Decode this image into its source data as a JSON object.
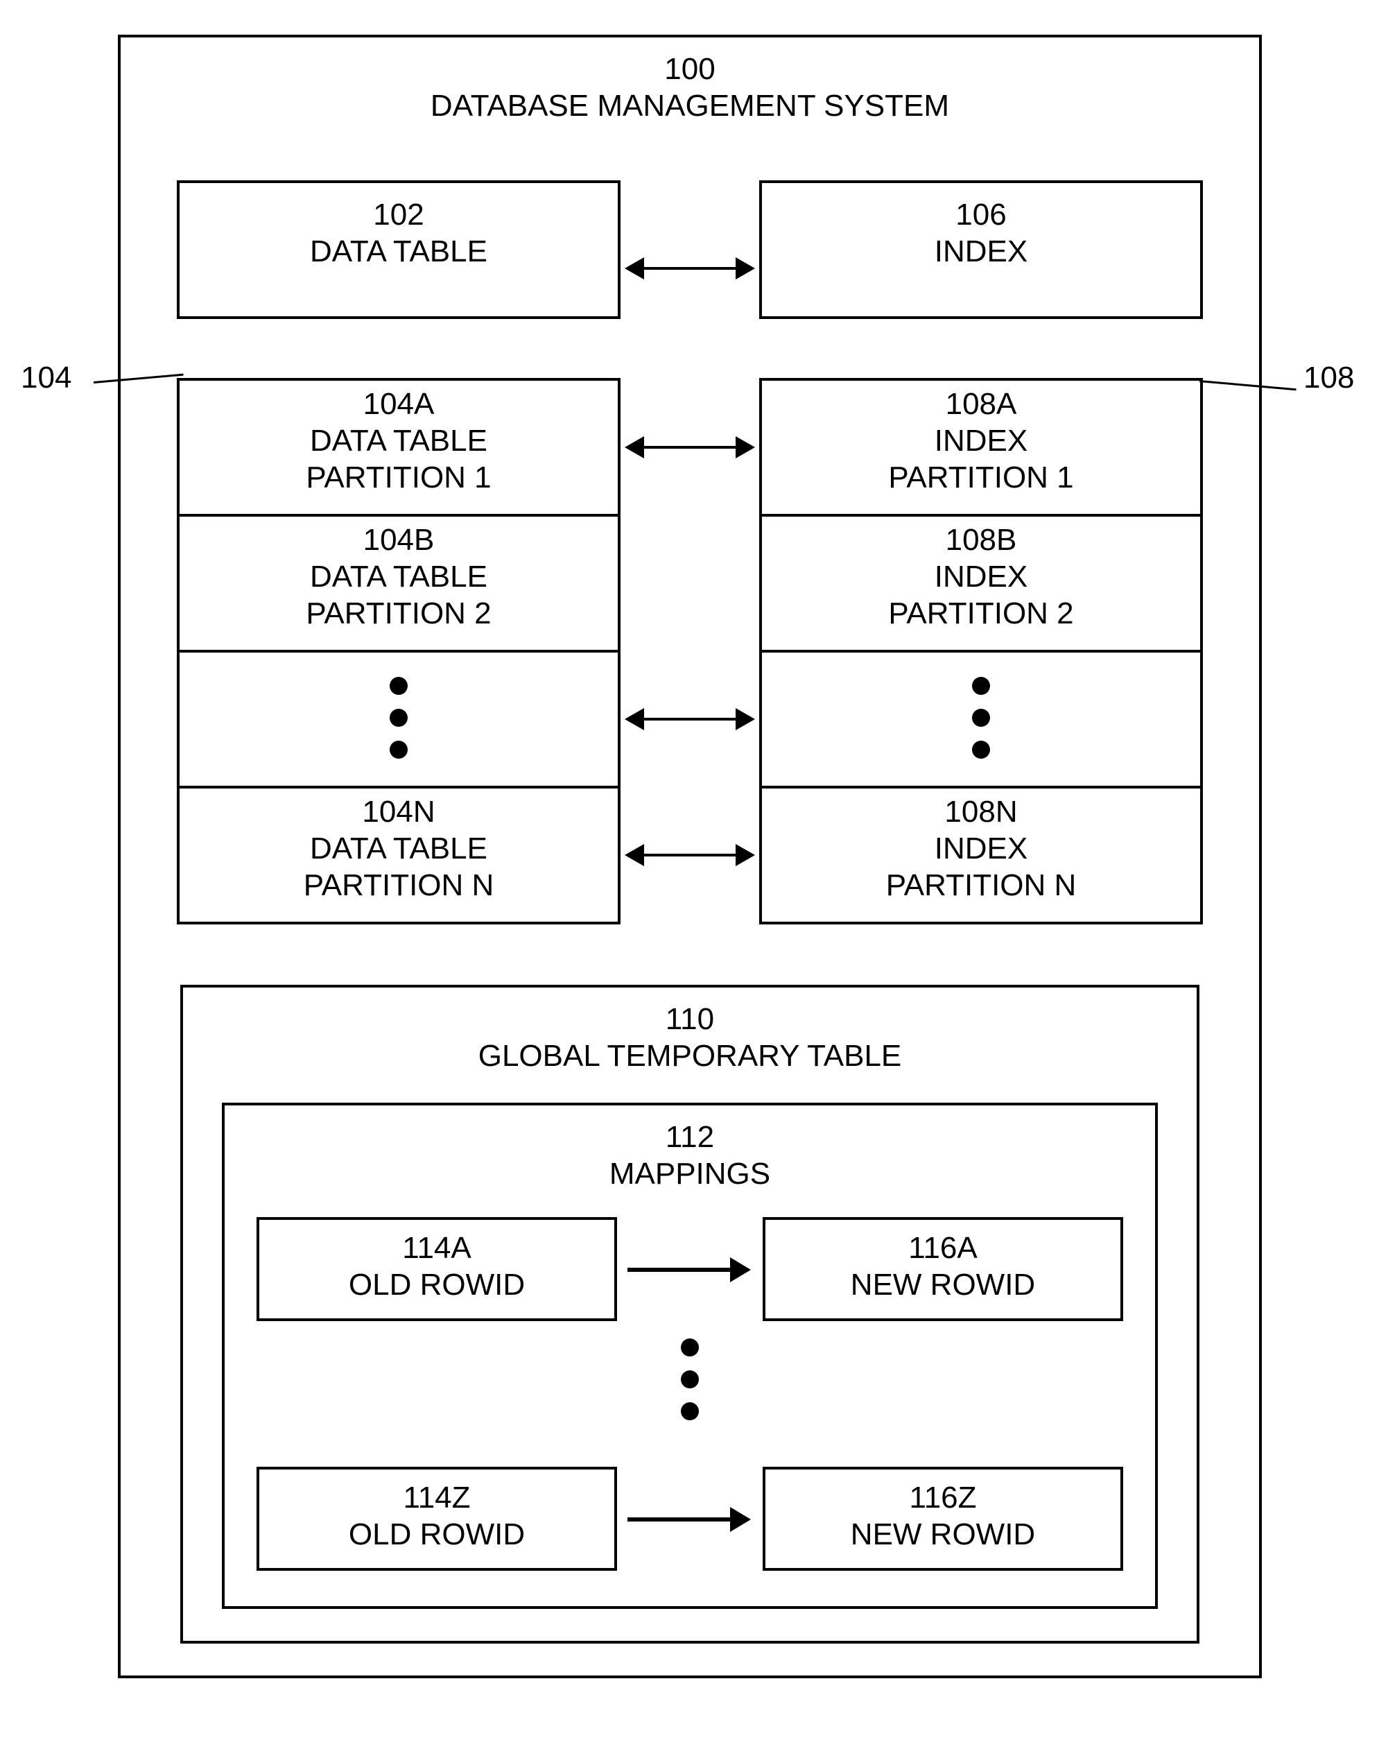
{
  "outer": {
    "ref": "100",
    "title": "DATABASE MANAGEMENT SYSTEM"
  },
  "dataTable": {
    "ref": "102",
    "title": "DATA TABLE"
  },
  "index": {
    "ref": "106",
    "title": "INDEX"
  },
  "leftGroupRef": "104",
  "rightGroupRef": "108",
  "dtp1": {
    "ref": "104A",
    "l1": "DATA TABLE",
    "l2": "PARTITION 1"
  },
  "dtp2": {
    "ref": "104B",
    "l1": "DATA TABLE",
    "l2": "PARTITION 2"
  },
  "dtpn": {
    "ref": "104N",
    "l1": "DATA TABLE",
    "l2": "PARTITION N"
  },
  "ip1": {
    "ref": "108A",
    "l1": "INDEX",
    "l2": "PARTITION 1"
  },
  "ip2": {
    "ref": "108B",
    "l1": "INDEX",
    "l2": "PARTITION 2"
  },
  "ipn": {
    "ref": "108N",
    "l1": "INDEX",
    "l2": "PARTITION N"
  },
  "gtt": {
    "ref": "110",
    "title": "GLOBAL TEMPORARY TABLE"
  },
  "map": {
    "ref": "112",
    "title": "MAPPINGS"
  },
  "old1": {
    "ref": "114A",
    "title": "OLD ROWID"
  },
  "new1": {
    "ref": "116A",
    "title": "NEW ROWID"
  },
  "old2": {
    "ref": "114Z",
    "title": "OLD ROWID"
  },
  "new2": {
    "ref": "116Z",
    "title": "NEW ROWID"
  }
}
